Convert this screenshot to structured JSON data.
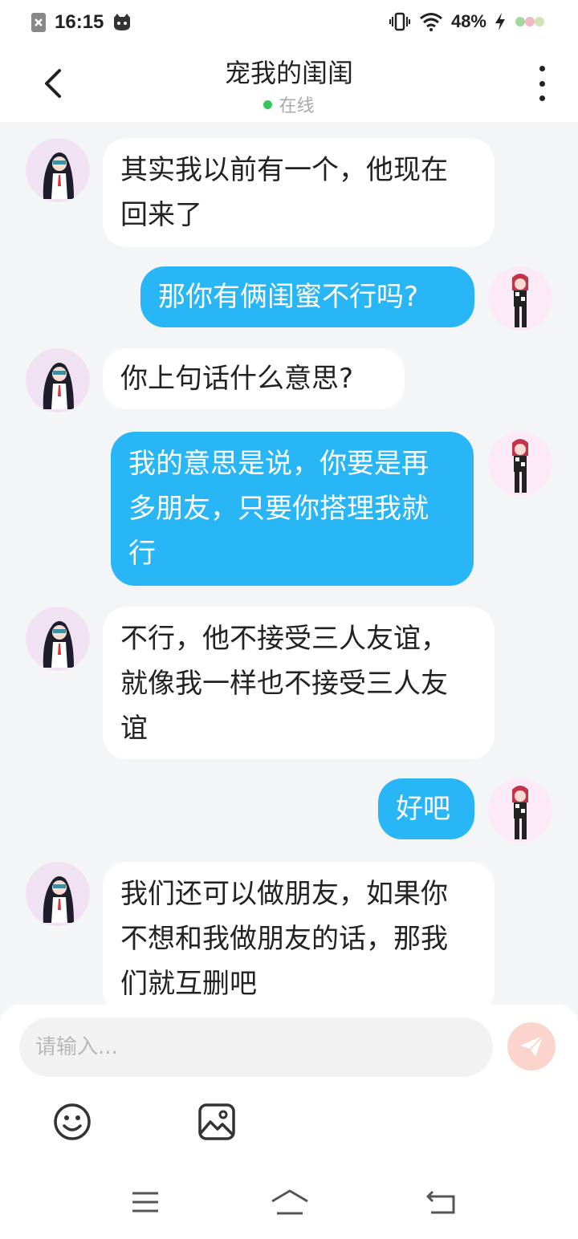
{
  "status_bar": {
    "time": "16:15",
    "battery": "48%"
  },
  "header": {
    "title": "宠我的闺闺",
    "status": "在线",
    "status_color": "#34c759"
  },
  "colors": {
    "outgoing_bubble": "#29b6f6",
    "incoming_bubble": "#ffffff",
    "background": "#f4f5f7",
    "send_button": "#fbd4ce"
  },
  "messages": [
    {
      "from": "them",
      "text": "其实我以前有一个，他现在\n回来了"
    },
    {
      "from": "me",
      "text": "那你有俩闺蜜不行吗?"
    },
    {
      "from": "them",
      "text": "你上句话什么意思?"
    },
    {
      "from": "me",
      "text": "我的意思是说，你要是再\n多朋友，只要你搭理我就\n行"
    },
    {
      "from": "them",
      "text": "不行，他不接受三人友谊，\n就像我一样也不接受三人友\n谊"
    },
    {
      "from": "me",
      "text": "好吧"
    },
    {
      "from": "them",
      "text": "我们还可以做朋友，如果你\n不想和我做朋友的话，那我\n们就互删吧"
    }
  ],
  "composer": {
    "placeholder": "请输入...",
    "value": "",
    "send_icon": "paper-plane-icon",
    "tools": [
      "emoji-icon",
      "image-icon"
    ]
  },
  "navbar": {
    "icons": [
      "menu-icon",
      "home-icon",
      "back-nav-icon"
    ]
  }
}
